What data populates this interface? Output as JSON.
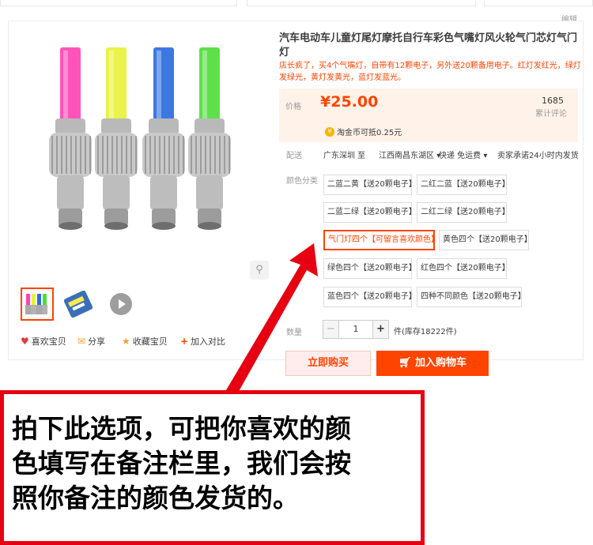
{
  "header": {
    "edit_label": "编辑"
  },
  "product": {
    "title": "汽车电动车儿童灯尾灯摩托自行车彩色气嘴灯风火轮气门芯灯气门灯",
    "subtitle": "店长疯了，买4个气嘴灯，自带有12颗电子，另外送20颗备用电子。红灯发红光，绿灯发绿光，黄灯发黄光，蓝灯发蓝光。"
  },
  "price": {
    "label": "价格",
    "value": "¥25.00",
    "review_count": "1685",
    "review_label": "累计评论",
    "coin_text": "淘金币可抵0.25元",
    "coin_icon": "coin-icon"
  },
  "shipping": {
    "label": "配送",
    "from": "广东深圳 至",
    "to": "江西南昌东湖区",
    "method": "快递 免运费",
    "promise": "卖家承诺24小时内发货"
  },
  "colors": {
    "label": "颜色分类",
    "options": [
      "二蓝二黄【送20颗电子】",
      "二红二蓝【送20颗电子】",
      "二蓝二绿【送20颗电子】",
      "二红二绿【送20颗电子】",
      "气门灯四个【可留言喜欢颜色】",
      "黄色四个【送20颗电子】",
      "绿色四个【送20颗电子】",
      "红色四个【送20颗电子】",
      "蓝色四个【送20颗电子】",
      "四种不同颜色【送20颗电子】"
    ],
    "selected_index": 4
  },
  "quantity": {
    "label": "数量",
    "value": "1",
    "minus": "−",
    "plus": "+",
    "stock": "件(库存18222件)"
  },
  "buttons": {
    "buy_now": "立即购买",
    "add_to_cart": "加入购物车",
    "cart_icon": "cart-icon"
  },
  "social": {
    "favorite": "喜欢宝贝",
    "share": "分享",
    "collect": "收藏宝贝",
    "compare": "加入对比"
  },
  "gallery": {
    "colors": [
      "#ff44b4",
      "#e8f23a",
      "#2d6de0",
      "#4fdd3a"
    ],
    "zoom_icon": "search-icon",
    "play_icon": "play-icon"
  },
  "annotation": {
    "text": "拍下此选项，可把你喜欢的颜\n色填写在备注栏里，我们会按\n照你备注的颜色发货的。",
    "color": "#e60012"
  }
}
